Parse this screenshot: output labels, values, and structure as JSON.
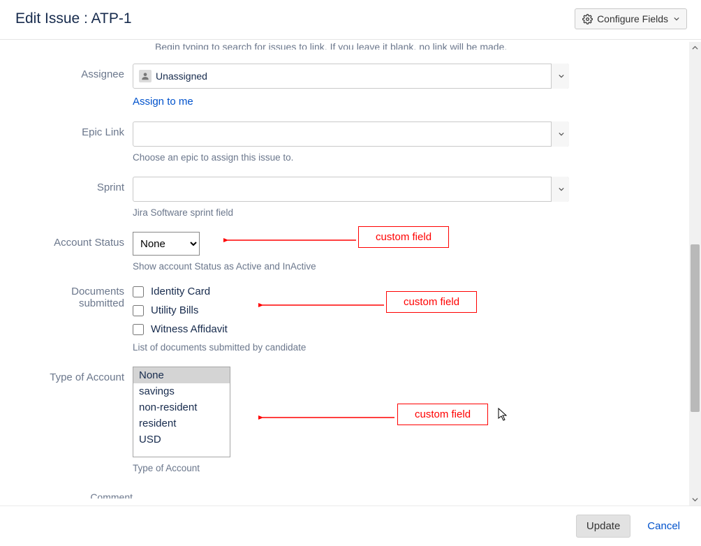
{
  "header": {
    "title": "Edit Issue : ATP-1",
    "configure_label": "Configure Fields"
  },
  "truncated_hint": "Begin typing to search for issues to link. If you leave it blank, no link will be made.",
  "assignee": {
    "label": "Assignee",
    "value": "Unassigned",
    "assign_to_me": "Assign to me"
  },
  "epic": {
    "label": "Epic Link",
    "helper": "Choose an epic to assign this issue to."
  },
  "sprint": {
    "label": "Sprint",
    "helper": "Jira Software sprint field"
  },
  "account_status": {
    "label": "Account Status",
    "value": "None",
    "helper": "Show account Status as Active and InActive"
  },
  "documents": {
    "label_line1": "Documents",
    "label_line2": "submitted",
    "options": [
      {
        "label": "Identity Card",
        "checked": false
      },
      {
        "label": "Utility Bills",
        "checked": false
      },
      {
        "label": "Witness Affidavit",
        "checked": false
      }
    ],
    "helper": "List of documents submitted by candidate"
  },
  "account_type": {
    "label": "Type of Account",
    "options": [
      {
        "label": "None",
        "selected": true
      },
      {
        "label": "savings",
        "selected": false
      },
      {
        "label": "non-resident",
        "selected": false
      },
      {
        "label": "resident",
        "selected": false
      },
      {
        "label": "USD",
        "selected": false
      }
    ],
    "helper": "Type of Account"
  },
  "comment": {
    "label": "Comment"
  },
  "annotation_text": "custom field",
  "footer": {
    "update": "Update",
    "cancel": "Cancel"
  }
}
